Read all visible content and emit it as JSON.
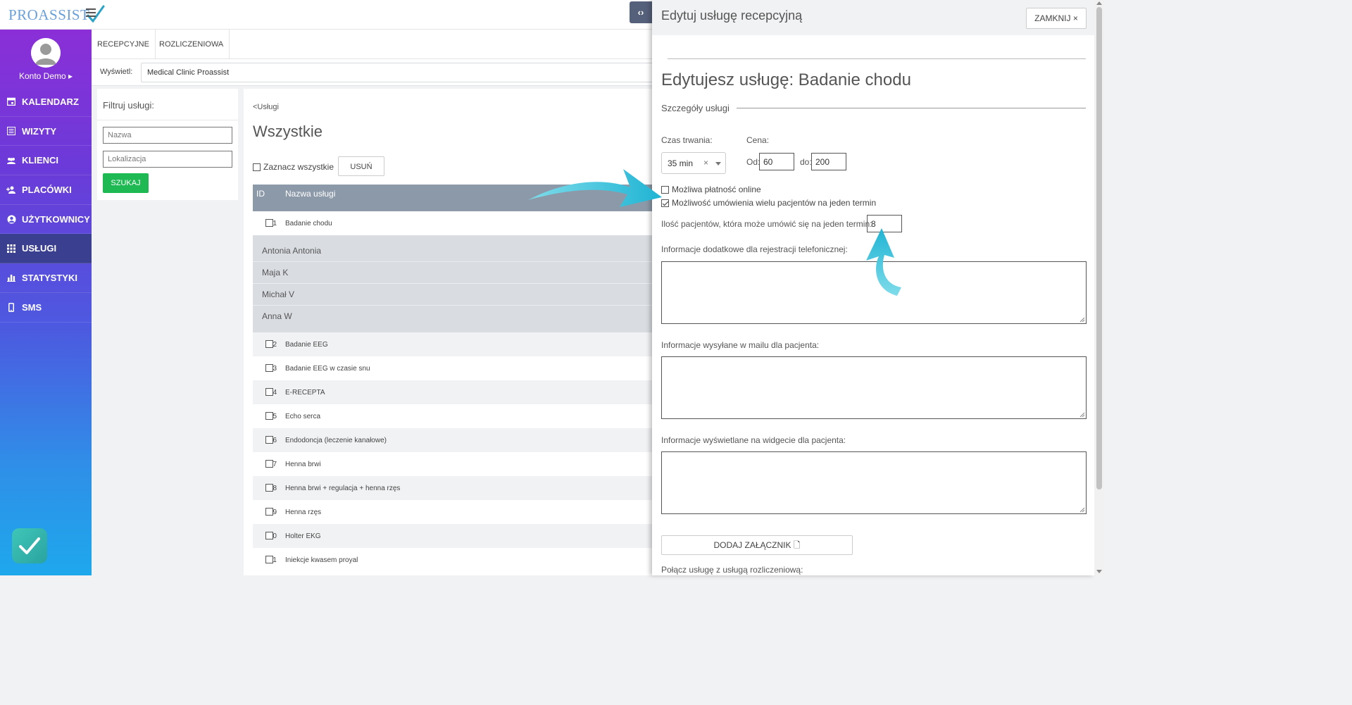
{
  "logo": {
    "text_main": "PRO",
    "text_accent": "ASSIST"
  },
  "sidebar": {
    "profile_name": "Konto Demo ▸",
    "items": [
      {
        "label": "KALENDARZ",
        "icon": "calendar-icon"
      },
      {
        "label": "WIZYTY",
        "icon": "list-icon"
      },
      {
        "label": "KLIENCI",
        "icon": "users-icon"
      },
      {
        "label": "PLACÓWKI",
        "icon": "user-plus-icon"
      },
      {
        "label": "UŻYTKOWNICY",
        "icon": "user-circle-icon"
      },
      {
        "label": "USŁUGI",
        "icon": "grid-icon",
        "active": true
      },
      {
        "label": "STATYSTYKI",
        "icon": "bar-chart-icon"
      },
      {
        "label": "SMS",
        "icon": "mobile-icon"
      }
    ]
  },
  "tabs": [
    "RECEPCYJNE",
    "ROZLICZENIOWA"
  ],
  "display": {
    "label": "Wyświetl:",
    "value": "Medical Clinic Proassist"
  },
  "filter": {
    "title": "Filtruj usługi:",
    "name_placeholder": "Nazwa",
    "location_placeholder": "Lokalizacja",
    "search_label": "SZUKAJ"
  },
  "list": {
    "breadcrumb": "<Usługi",
    "title": "Wszystkie",
    "select_all": "Zaznacz wszystkie",
    "delete_label": "USUŃ",
    "columns": {
      "id": "ID",
      "name": "Nazwa usługi"
    },
    "first_row": {
      "id": "1",
      "name": "Badanie chodu"
    },
    "sub_items": [
      "Antonia Antonia",
      "Maja K",
      "Michał V",
      "Anna W"
    ],
    "rows": [
      {
        "id": "2",
        "name": "Badanie EEG"
      },
      {
        "id": "3",
        "name": "Badanie EEG w czasie snu"
      },
      {
        "id": "4",
        "name": "E-RECEPTA"
      },
      {
        "id": "5",
        "name": "Echo serca"
      },
      {
        "id": "6",
        "name": "Endodoncja (leczenie kanałowe)"
      },
      {
        "id": "7",
        "name": "Henna brwi"
      },
      {
        "id": "8",
        "name": "Henna brwi + regulacja + henna rzęs"
      },
      {
        "id": "9",
        "name": "Henna rzęs"
      },
      {
        "id": "10",
        "name": "Holter EKG"
      },
      {
        "id": "11",
        "name": "Iniekcje kwasem proyal"
      }
    ]
  },
  "toggle_label": "‹›",
  "panel": {
    "title": "Edytuj usługę recepcyjną",
    "close_label": "ZAMKNIJ ×",
    "edit_title": "Edytujesz usługę: Badanie chodu",
    "section": "Szczegóły usługi",
    "duration_label": "Czas trwania:",
    "duration_value": "35 min",
    "duration_clear": "×",
    "price_label": "Cena:",
    "price_from_label": "Od:",
    "price_from": "60",
    "price_to_label": "do:",
    "price_to": "200",
    "online_payment": "Możliwa płatność online",
    "multi_patients": "Możliwość umówienia wielu pacjentów na jeden termin",
    "patients_count_label": "Ilość pacjentów, która może umówić się na jeden termin:",
    "patients_count": "8",
    "phone_info_label": "Informacje dodatkowe dla rejestracji telefonicznej:",
    "email_info_label": "Informacje wysyłane w mailu dla pacjenta:",
    "widget_info_label": "Informacje wyświetlane na widgecie dla pacjenta:",
    "attach_label": "DODAJ ZAŁĄCZNIK 🗋",
    "link_label": "Połącz usługę z usługą rozliczeniową:"
  },
  "colors": {
    "accent_green": "#1fb954",
    "header_row": "#8c99a8",
    "sidebar_active": "#3a3f8f",
    "arrow": "#2fc4dc"
  }
}
